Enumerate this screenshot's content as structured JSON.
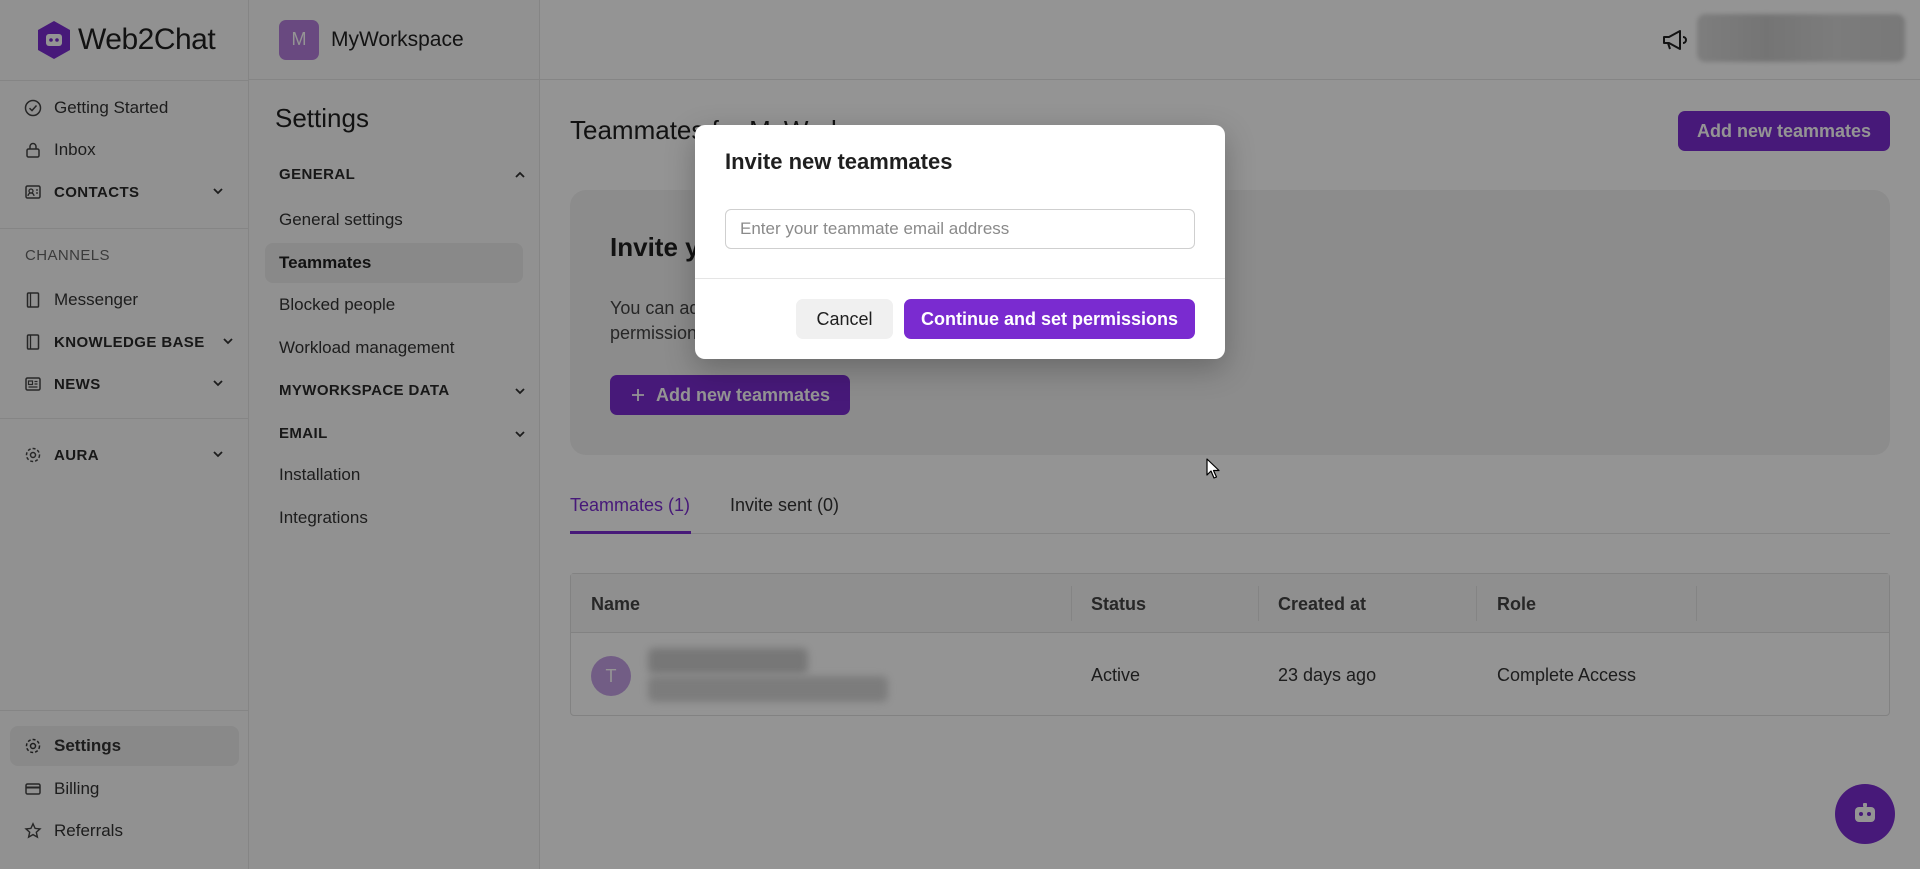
{
  "brand": {
    "name": "Web2Chat"
  },
  "nav": {
    "getting_started": "Getting Started",
    "inbox": "Inbox",
    "contacts": "CONTACTS",
    "channels_section": "CHANNELS",
    "messenger": "Messenger",
    "knowledge_base": "KNOWLEDGE BASE",
    "news": "NEWS",
    "aura": "AURA",
    "settings": "Settings",
    "billing": "Billing",
    "referrals": "Referrals"
  },
  "workspace": {
    "initial": "M",
    "name": "MyWorkspace"
  },
  "settings_menu": {
    "title": "Settings",
    "general": "GENERAL",
    "general_settings": "General settings",
    "teammates": "Teammates",
    "blocked_people": "Blocked people",
    "workload_management": "Workload management",
    "workspace_data": "MYWORKSPACE DATA",
    "email": "EMAIL",
    "installation": "Installation",
    "integrations": "Integrations"
  },
  "main": {
    "title": "Teammates for MyWorkspace",
    "add_button": "Add new teammates",
    "invite_card": {
      "heading": "Invite your teammates",
      "description": "You can add teammates and set their permissions",
      "add_button": "Add new teammates"
    },
    "tabs": [
      {
        "label": "Teammates (1)"
      },
      {
        "label": "Invite sent (0)"
      }
    ],
    "table": {
      "headers": {
        "name": "Name",
        "status": "Status",
        "created": "Created at",
        "role": "Role"
      },
      "rows": [
        {
          "initial": "T",
          "status": "Active",
          "created": "23 days ago",
          "role": "Complete Access"
        }
      ]
    }
  },
  "modal": {
    "title": "Invite new teammates",
    "input_placeholder": "Enter your teammate email address",
    "input_value": "",
    "cancel": "Cancel",
    "continue": "Continue and set permissions"
  },
  "colors": {
    "accent": "#7a2bd0",
    "avatar": "#b57edc"
  },
  "icons": [
    "check-circle-icon",
    "lock-icon",
    "contacts-icon",
    "book-icon",
    "news-icon",
    "gear-icon",
    "card-icon",
    "star-icon",
    "megaphone-icon",
    "chevron-down-icon",
    "chevron-up-icon",
    "plus-icon",
    "bot-icon"
  ]
}
